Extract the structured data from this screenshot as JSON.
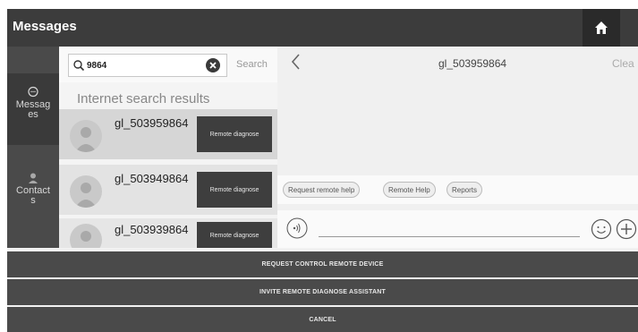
{
  "header": {
    "title": "Messages"
  },
  "nav": {
    "messages_label": "Messages",
    "contacts_label": "Contacts"
  },
  "search": {
    "value": "9864",
    "button_label": "Search",
    "results_title": "Internet search results"
  },
  "results": [
    {
      "name": "gl_503959864",
      "action_label": "Remote diagnose"
    },
    {
      "name": "gl_503949864",
      "action_label": "Remote diagnose"
    },
    {
      "name": "gl_503939864",
      "action_label": "Remote diagnose"
    }
  ],
  "chat": {
    "title": "gl_503959864",
    "clear_label": "Clea",
    "quick_actions": [
      "Request remote help",
      "Remote Help",
      "Reports"
    ]
  },
  "actions": {
    "request_control": "REQUEST CONTROL REMOTE DEVICE",
    "invite_assistant": "INVITE REMOTE DIAGNOSE ASSISTANT",
    "cancel": "CANCEL"
  },
  "icons": {
    "home": "home-icon",
    "messages": "chat-bubble-icon",
    "contacts": "person-icon",
    "search": "search-icon",
    "clear": "clear-circle-icon",
    "back": "chevron-left-icon",
    "voice": "voice-icon",
    "emoji": "smiley-icon",
    "plus": "plus-circle-icon"
  },
  "colors": {
    "titlebar": "#3c3c3c",
    "nav": "#4a4a4a",
    "action_button": "#4a4a4a",
    "diagnose_button": "#3e3e3e",
    "selected_row": "#d6d6d6"
  }
}
